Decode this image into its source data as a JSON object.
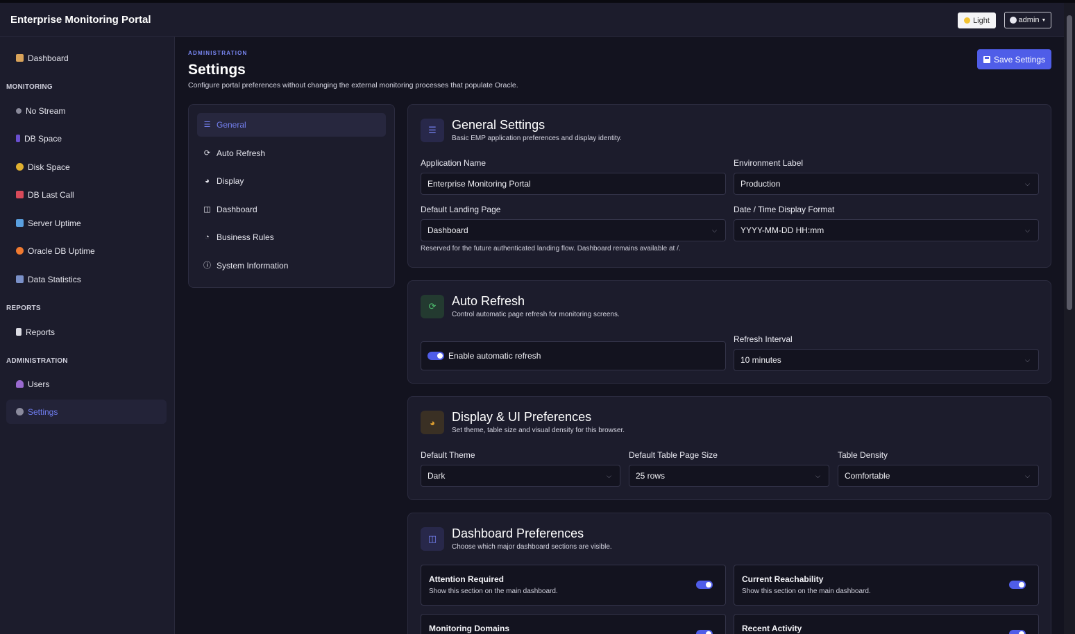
{
  "app": {
    "brand": "Enterprise Monitoring Portal",
    "theme_toggle_label": "Light",
    "user_label": "admin"
  },
  "sidebar": {
    "top_item": {
      "label": "Dashboard",
      "icon": "house-icon"
    },
    "sections": [
      {
        "heading": "MONITORING",
        "items": [
          {
            "label": "No Stream",
            "icon": "satellite-icon"
          },
          {
            "label": "DB Space",
            "icon": "database-icon"
          },
          {
            "label": "Disk Space",
            "icon": "disk-icon"
          },
          {
            "label": "DB Last Call",
            "icon": "telephone-icon"
          },
          {
            "label": "Server Uptime",
            "icon": "monitor-icon"
          },
          {
            "label": "Oracle DB Uptime",
            "icon": "orange-circle-icon"
          },
          {
            "label": "Data Statistics",
            "icon": "bar-chart-icon"
          }
        ]
      },
      {
        "heading": "REPORTS",
        "items": [
          {
            "label": "Reports",
            "icon": "document-icon"
          }
        ]
      },
      {
        "heading": "ADMINISTRATION",
        "items": [
          {
            "label": "Users",
            "icon": "user-icon"
          },
          {
            "label": "Settings",
            "icon": "gear-icon",
            "active": true
          }
        ]
      }
    ]
  },
  "header": {
    "eyebrow": "ADMINISTRATION",
    "title": "Settings",
    "subtitle": "Configure portal preferences without changing the external monitoring processes that populate Oracle.",
    "save_label": "Save Settings"
  },
  "subnav": [
    {
      "label": "General",
      "icon": "sliders-icon",
      "active": true
    },
    {
      "label": "Auto Refresh",
      "icon": "refresh-icon"
    },
    {
      "label": "Display",
      "icon": "palette-icon"
    },
    {
      "label": "Dashboard",
      "icon": "layout-icon"
    },
    {
      "label": "Business Rules",
      "icon": "rules-icon"
    },
    {
      "label": "System Information",
      "icon": "info-icon"
    }
  ],
  "general": {
    "title": "General Settings",
    "subtitle": "Basic EMP application preferences and display identity.",
    "app_name_label": "Application Name",
    "app_name_value": "Enterprise Monitoring Portal",
    "env_label": "Environment Label",
    "env_value": "Production",
    "landing_label": "Default Landing Page",
    "landing_value": "Dashboard",
    "landing_hint": "Reserved for the future authenticated landing flow. Dashboard remains available at /.",
    "datetime_label": "Date / Time Display Format",
    "datetime_value": "YYYY-MM-DD HH:mm"
  },
  "auto_refresh": {
    "title": "Auto Refresh",
    "subtitle": "Control automatic page refresh for monitoring screens.",
    "toggle_label": "Enable automatic refresh",
    "toggle_on": true,
    "interval_label": "Refresh Interval",
    "interval_value": "10 minutes"
  },
  "display": {
    "title": "Display & UI Preferences",
    "subtitle": "Set theme, table size and visual density for this browser.",
    "theme_label": "Default Theme",
    "theme_value": "Dark",
    "page_size_label": "Default Table Page Size",
    "page_size_value": "25 rows",
    "density_label": "Table Density",
    "density_value": "Comfortable"
  },
  "dashboard_prefs": {
    "title": "Dashboard Preferences",
    "subtitle": "Choose which major dashboard sections are visible.",
    "items": [
      {
        "title": "Attention Required",
        "sub": "Show this section on the main dashboard.",
        "on": true
      },
      {
        "title": "Current Reachability",
        "sub": "Show this section on the main dashboard.",
        "on": true
      },
      {
        "title": "Monitoring Domains",
        "sub": "",
        "on": true
      },
      {
        "title": "Recent Activity",
        "sub": "",
        "on": true
      }
    ]
  },
  "colors": {
    "accent": "#4f5de8",
    "background": "#13131f",
    "panel": "#1c1c2c"
  }
}
